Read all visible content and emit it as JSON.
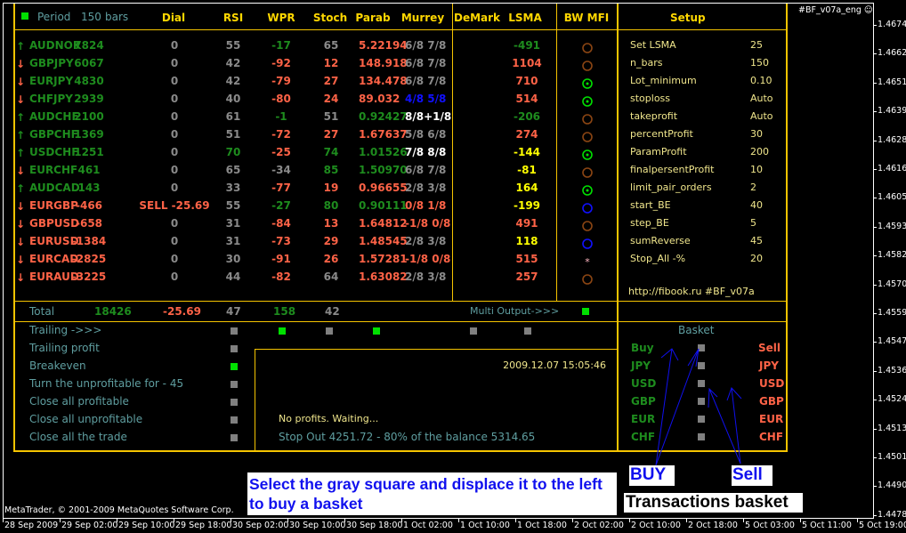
{
  "header": {
    "period_label": "Period",
    "bars": "150",
    "bars_label": "bars",
    "period_indicator_color": "#00e000",
    "columns": [
      "Dial",
      "RSI",
      "WPR",
      "Stoch",
      "Parab",
      "Murrey",
      "DeMark",
      "LSMA",
      "BW MFI"
    ],
    "setup_title": "Setup"
  },
  "colors": {
    "green": "#1e8c1e",
    "red": "#ff6347",
    "gray": "#8a8a8a",
    "white": "#ffffff",
    "blue": "#1010ff",
    "yellow": "#ffff00",
    "brown": "#8b4513",
    "lime": "#00e000"
  },
  "rows": [
    {
      "dir": "up",
      "pair": "AUDNOK",
      "value": "7824",
      "dial": "0",
      "rsi": "55",
      "wpr": "-17",
      "stoch": "65",
      "parab": "5.22194",
      "murrey": "6/8 7/8",
      "lsma": "-491",
      "mfi": "circle-brown",
      "c": [
        "green",
        "green",
        "gray",
        "gray",
        "green",
        "gray",
        "red",
        "gray",
        "green"
      ]
    },
    {
      "dir": "down",
      "pair": "GBPJPY",
      "value": "6067",
      "dial": "0",
      "rsi": "42",
      "wpr": "-92",
      "stoch": "12",
      "parab": "148.918",
      "murrey": "6/8 7/8",
      "lsma": "1104",
      "mfi": "circle-brown",
      "c": [
        "green",
        "green",
        "gray",
        "gray",
        "red",
        "red",
        "red",
        "gray",
        "red"
      ]
    },
    {
      "dir": "down",
      "pair": "EURJPY",
      "value": "4830",
      "dial": "0",
      "rsi": "42",
      "wpr": "-79",
      "stoch": "27",
      "parab": "134.478",
      "murrey": "6/8 7/8",
      "lsma": "710",
      "mfi": "target-green",
      "c": [
        "green",
        "green",
        "gray",
        "gray",
        "red",
        "red",
        "red",
        "gray",
        "red"
      ]
    },
    {
      "dir": "down",
      "pair": "CHFJPY",
      "value": "2939",
      "dial": "0",
      "rsi": "40",
      "wpr": "-80",
      "stoch": "24",
      "parab": "89.032",
      "murrey": "4/8 5/8",
      "lsma": "514",
      "mfi": "target-green",
      "c": [
        "green",
        "green",
        "gray",
        "gray",
        "red",
        "red",
        "red",
        "blue",
        "red"
      ]
    },
    {
      "dir": "up",
      "pair": "AUDCHF",
      "value": "2100",
      "dial": "0",
      "rsi": "61",
      "wpr": "-1",
      "stoch": "51",
      "parab": "0.92427",
      "murrey": "8/8+1/8",
      "lsma": "-206",
      "mfi": "circle-brown",
      "c": [
        "green",
        "green",
        "gray",
        "gray",
        "green",
        "gray",
        "green",
        "white",
        "green"
      ]
    },
    {
      "dir": "up",
      "pair": "GBPCHF",
      "value": "1369",
      "dial": "0",
      "rsi": "51",
      "wpr": "-72",
      "stoch": "27",
      "parab": "1.67637",
      "murrey": "5/8 6/8",
      "lsma": "274",
      "mfi": "circle-brown",
      "c": [
        "green",
        "green",
        "gray",
        "gray",
        "red",
        "red",
        "red",
        "gray",
        "red"
      ]
    },
    {
      "dir": "up",
      "pair": "USDCHF",
      "value": "1251",
      "dial": "0",
      "rsi": "70",
      "wpr": "-25",
      "stoch": "74",
      "parab": "1.01526",
      "murrey": "7/8 8/8",
      "lsma": "-144",
      "mfi": "target-green",
      "c": [
        "green",
        "green",
        "gray",
        "green",
        "red",
        "green",
        "green",
        "white",
        "yellow"
      ]
    },
    {
      "dir": "down",
      "pair": "EURCHF",
      "value": "461",
      "dial": "0",
      "rsi": "65",
      "wpr": "-34",
      "stoch": "85",
      "parab": "1.50970",
      "murrey": "6/8 7/8",
      "lsma": "-81",
      "mfi": "circle-brown",
      "c": [
        "green",
        "green",
        "gray",
        "gray",
        "gray",
        "green",
        "green",
        "gray",
        "yellow"
      ]
    },
    {
      "dir": "up",
      "pair": "AUDCAD",
      "value": "143",
      "dial": "0",
      "rsi": "33",
      "wpr": "-77",
      "stoch": "19",
      "parab": "0.96655",
      "murrey": "2/8 3/8",
      "lsma": "164",
      "mfi": "target-green",
      "c": [
        "green",
        "green",
        "gray",
        "gray",
        "red",
        "red",
        "red",
        "gray",
        "yellow"
      ]
    },
    {
      "dir": "down",
      "pair": "EURGBP",
      "value": "-466",
      "dial": "SELL -25.69",
      "rsi": "55",
      "wpr": "-27",
      "stoch": "80",
      "parab": "0.90111",
      "murrey": "0/8 1/8",
      "lsma": "-199",
      "mfi": "circle-blue",
      "c": [
        "red",
        "red",
        "red",
        "gray",
        "green",
        "green",
        "green",
        "red",
        "yellow"
      ]
    },
    {
      "dir": "down",
      "pair": "GBPUSD",
      "value": "-658",
      "dial": "0",
      "rsi": "31",
      "wpr": "-84",
      "stoch": "13",
      "parab": "1.64812",
      "murrey": "-1/8 0/8",
      "lsma": "491",
      "mfi": "circle-brown",
      "c": [
        "red",
        "red",
        "gray",
        "gray",
        "red",
        "red",
        "red",
        "red",
        "red"
      ]
    },
    {
      "dir": "down",
      "pair": "EURUSD",
      "value": "-1384",
      "dial": "0",
      "rsi": "31",
      "wpr": "-73",
      "stoch": "29",
      "parab": "1.48545",
      "murrey": "2/8 3/8",
      "lsma": "118",
      "mfi": "circle-blue",
      "c": [
        "red",
        "red",
        "gray",
        "gray",
        "red",
        "red",
        "red",
        "gray",
        "yellow"
      ]
    },
    {
      "dir": "down",
      "pair": "EURCAD",
      "value": "-2825",
      "dial": "0",
      "rsi": "30",
      "wpr": "-91",
      "stoch": "26",
      "parab": "1.57281",
      "murrey": "-1/8 0/8",
      "lsma": "515",
      "mfi": "star-pink",
      "c": [
        "red",
        "red",
        "gray",
        "gray",
        "red",
        "red",
        "red",
        "red",
        "red"
      ]
    },
    {
      "dir": "down",
      "pair": "EURAUD",
      "value": "-3225",
      "dial": "0",
      "rsi": "44",
      "wpr": "-82",
      "stoch": "64",
      "parab": "1.63082",
      "murrey": "2/8 3/8",
      "lsma": "257",
      "mfi": "circle-brown",
      "c": [
        "red",
        "red",
        "gray",
        "gray",
        "red",
        "gray",
        "red",
        "gray",
        "red"
      ]
    }
  ],
  "total": {
    "label": "Total",
    "value": "18426",
    "dial": "-25.69",
    "rsi": "47",
    "wpr": "158",
    "stoch": "42",
    "multi_output": "Multi Output->>>",
    "multi_output_on": true
  },
  "controls": [
    {
      "label": "Trailing    ->>>",
      "on": false
    },
    {
      "label": "Trailing profit",
      "on": false
    },
    {
      "label": "Breakeven",
      "on": true
    },
    {
      "label": "Turn the unprofitable for - 45",
      "on": false
    },
    {
      "label": "Close all profitable",
      "on": false
    },
    {
      "label": "Close all unprofitable",
      "on": false
    },
    {
      "label": "Close all the trade",
      "on": false
    }
  ],
  "trailing_switches": [
    true,
    false,
    true,
    false,
    false
  ],
  "message": {
    "datetime": "2009.12.07 15:05:46",
    "status": "No profits. Waiting...",
    "stop_out": "Stop Out   4251.72 - 80%  of the balance  5314.65"
  },
  "setup": [
    {
      "k": "Set LSMA",
      "v": "25"
    },
    {
      "k": "n_bars",
      "v": "150"
    },
    {
      "k": "Lot_minimum",
      "v": "0.10"
    },
    {
      "k": "stoploss",
      "v": "Auto"
    },
    {
      "k": "takeprofit",
      "v": "Auto"
    },
    {
      "k": "percentProfit",
      "v": "30"
    },
    {
      "k": "ParamProfit",
      "v": "200"
    },
    {
      "k": "finalpersentProfit",
      "v": "10"
    },
    {
      "k": "limit_pair_orders",
      "v": "2"
    },
    {
      "k": "start_BE",
      "v": "40"
    },
    {
      "k": "step_BE",
      "v": "5"
    },
    {
      "k": "sumReverse",
      "v": "45"
    },
    {
      "k": "Stop_All -%",
      "v": "20"
    }
  ],
  "setup_link": "http://fibook.ru  #BF_v07a",
  "basket": {
    "title": "Basket",
    "buy": "Buy",
    "sell": "Sell",
    "currencies": [
      "JPY",
      "USD",
      "GBP",
      "EUR",
      "CHF"
    ]
  },
  "expert_label": "#BF_v07a_eng",
  "copyright": "MetaTrader, © 2001-2009 MetaQuotes Software Corp.",
  "annotations": {
    "instruction": "Select the gray square and displace it to the left to buy a basket",
    "buy": "BUY",
    "sell": "Sell",
    "basket_caption": "Transactions basket"
  },
  "price_axis": [
    "1.46740",
    "1.46625",
    "1.46510",
    "1.46395",
    "1.46280",
    "1.46165",
    "1.46050",
    "1.45935",
    "1.45820",
    "1.45705",
    "1.45590",
    "1.45475",
    "1.45360",
    "1.45245",
    "1.45130",
    "1.45015",
    "1.44900",
    "1.44785"
  ],
  "time_axis": [
    "28 Sep 2009",
    "29 Sep 02:00",
    "29 Sep 10:00",
    "29 Sep 18:00",
    "30 Sep 02:00",
    "30 Sep 10:00",
    "30 Sep 18:00",
    "1 Oct 02:00",
    "1 Oct 10:00",
    "1 Oct 18:00",
    "2 Oct 02:00",
    "2 Oct 10:00",
    "2 Oct 18:00",
    "5 Oct 03:00",
    "5 Oct 11:00",
    "5 Oct 19:00"
  ]
}
